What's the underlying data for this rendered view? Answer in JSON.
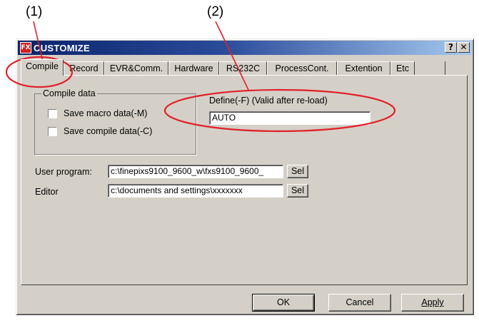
{
  "callouts": {
    "c1": "(1)",
    "c2": "(2)"
  },
  "window": {
    "title": "CUSTOMIZE",
    "icon": "app-icon",
    "help_label": "?",
    "close_label": "✕"
  },
  "tabs": [
    {
      "label": "Compile",
      "active": true
    },
    {
      "label": "Record"
    },
    {
      "label": "EVR&Comm."
    },
    {
      "label": "Hardware"
    },
    {
      "label": "RS232C"
    },
    {
      "label": "ProcessCont."
    },
    {
      "label": "Extention"
    },
    {
      "label": "Etc"
    }
  ],
  "compile": {
    "group_title": "Compile data",
    "save_macro_label": "Save macro data(-M)",
    "save_compile_label": "Save compile data(-C)",
    "define_label": "Define(-F) (Valid after re-load)",
    "define_value": "AUTO",
    "user_program_label": "User program:",
    "user_program_value": "c:\\finepixs9100_9600_w\\fxs9100_9600_",
    "editor_label": "Editor",
    "editor_value": "c:\\documents and settings\\xxxxxxx",
    "sel_label": "Sel"
  },
  "buttons": {
    "ok": "OK",
    "cancel": "Cancel",
    "apply": "Apply"
  },
  "colors": {
    "callout_red": "#e0202a",
    "face": "#d4d0c8",
    "titlebar_start": "#0a246a",
    "titlebar_end": "#a6caf0"
  }
}
